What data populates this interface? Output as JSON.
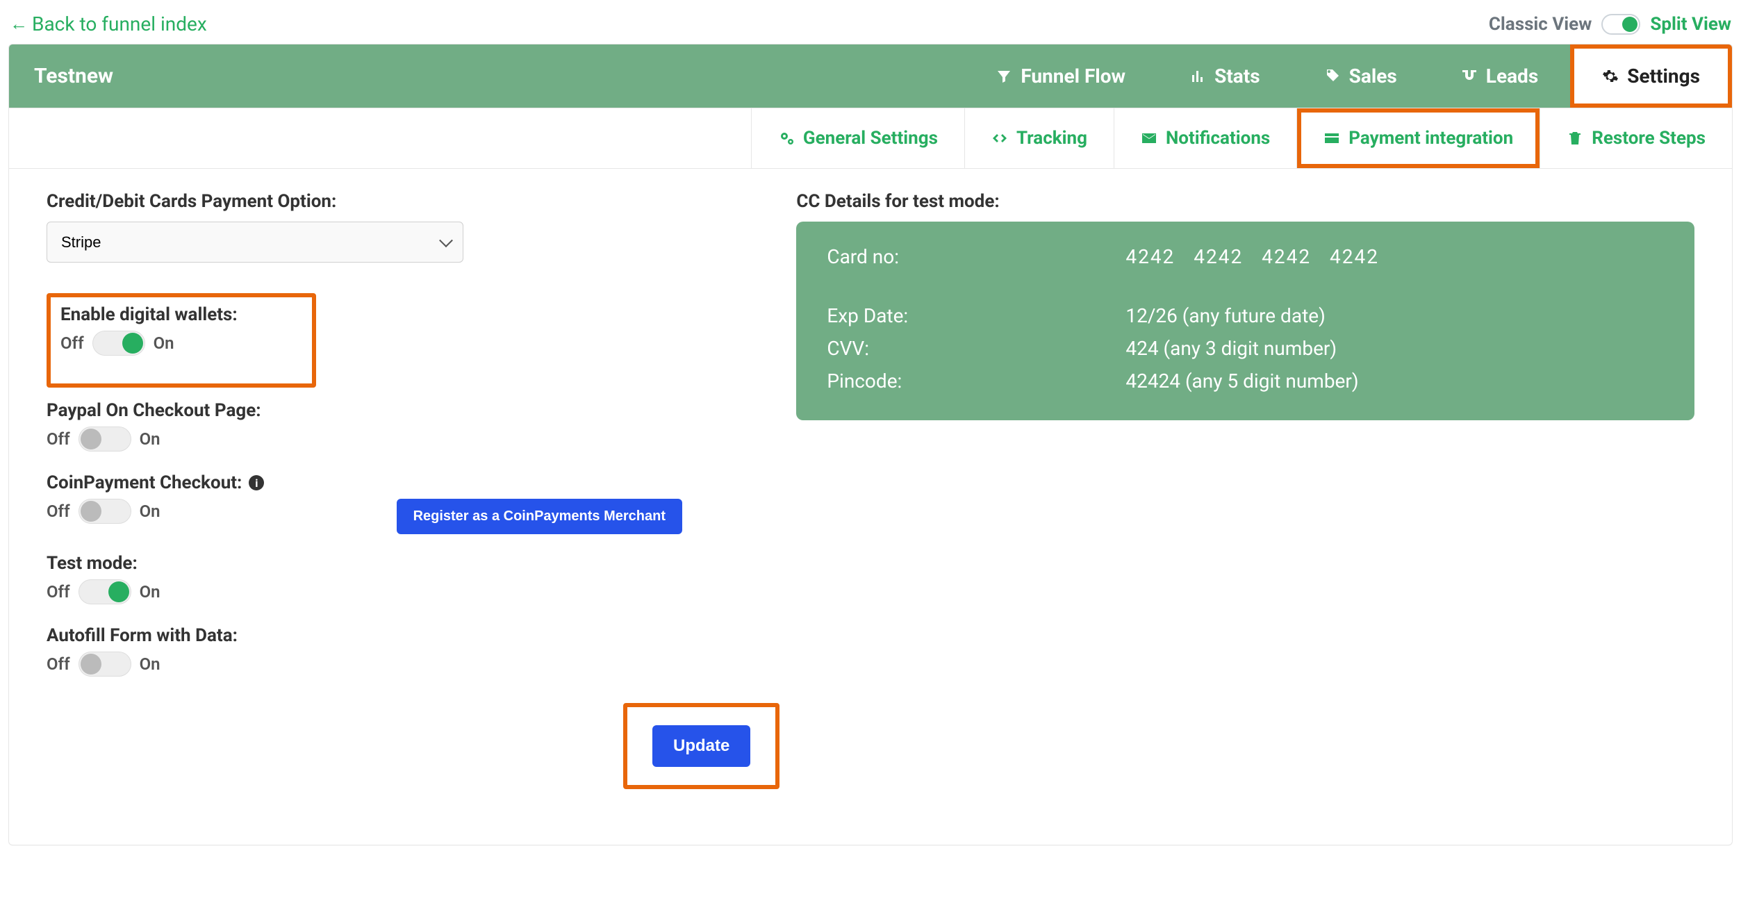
{
  "back_link": "Back to funnel index",
  "view": {
    "classic": "Classic View",
    "split": "Split View"
  },
  "funnel_name": "Testnew",
  "nav": {
    "flow": "Funnel Flow",
    "stats": "Stats",
    "sales": "Sales",
    "leads": "Leads",
    "settings": "Settings"
  },
  "subtabs": {
    "general": "General Settings",
    "tracking": "Tracking",
    "notifications": "Notifications",
    "payment": "Payment integration",
    "restore": "Restore Steps"
  },
  "left": {
    "card_option_label": "Credit/Debit Cards Payment Option:",
    "card_option_value": "Stripe",
    "wallets_label": "Enable digital wallets:",
    "paypal_label": "Paypal On Checkout Page:",
    "coin_label": "CoinPayment Checkout:",
    "test_label": "Test mode:",
    "autofill_label": "Autofill Form with Data:",
    "off": "Off",
    "on": "On",
    "coin_register": "Register as a CoinPayments Merchant",
    "update": "Update"
  },
  "right": {
    "heading": "CC Details for test mode:",
    "card_no_label": "Card no:",
    "card_no_val": "4242 4242 4242 4242",
    "exp_label": "Exp Date:",
    "exp_val": "12/26 (any future date)",
    "cvv_label": "CVV:",
    "cvv_val": "424 (any 3 digit number)",
    "pin_label": "Pincode:",
    "pin_val": "42424 (any 5 digit number)"
  }
}
